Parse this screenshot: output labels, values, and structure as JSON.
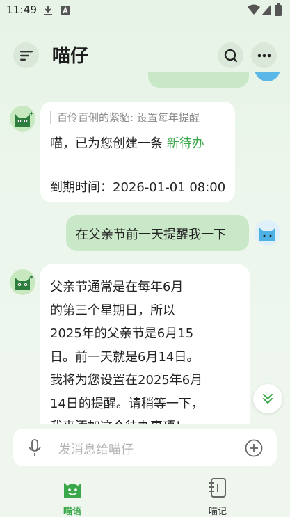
{
  "status_bar": {
    "time": "11:49",
    "icons": [
      "download-icon",
      "notification-a-icon",
      "wifi-icon",
      "signal-icon",
      "battery-icon"
    ]
  },
  "header": {
    "title": "喵仔",
    "menu_icon": "menu-icon",
    "search_icon": "search-icon",
    "more_icon": "more-icon"
  },
  "messages": [
    {
      "role": "bot",
      "quote": "百伶百俐的紫貂: 设置每年提醒",
      "text_prefix": "喵，已为您创建一条",
      "link_text": "新待办",
      "due": "到期时间：2026-01-01 08:00"
    },
    {
      "role": "user",
      "text": "在父亲节前一天提醒我一下"
    },
    {
      "role": "bot",
      "text": "父亲节通常是在每年6月\n的第三个星期日，所以\n2025年的父亲节是6月15\n日。前一天就是6月14日。\n我将为您设置在2025年6月\n14日的提醒。请稍等一下，\n我来添加这个待办事项！"
    }
  ],
  "input": {
    "placeholder": "发消息给喵仔",
    "voice_icon": "microphone-icon",
    "add_icon": "plus-circle-icon"
  },
  "bottom_nav": {
    "items": [
      {
        "label": "喵语",
        "icon": "cat-chat-icon",
        "active": true
      },
      {
        "label": "喵记",
        "icon": "notebook-icon",
        "active": false
      }
    ]
  },
  "colors": {
    "accent": "#3aa84a",
    "user_bubble": "#c9e8c8",
    "background": "#eaf5e9"
  }
}
